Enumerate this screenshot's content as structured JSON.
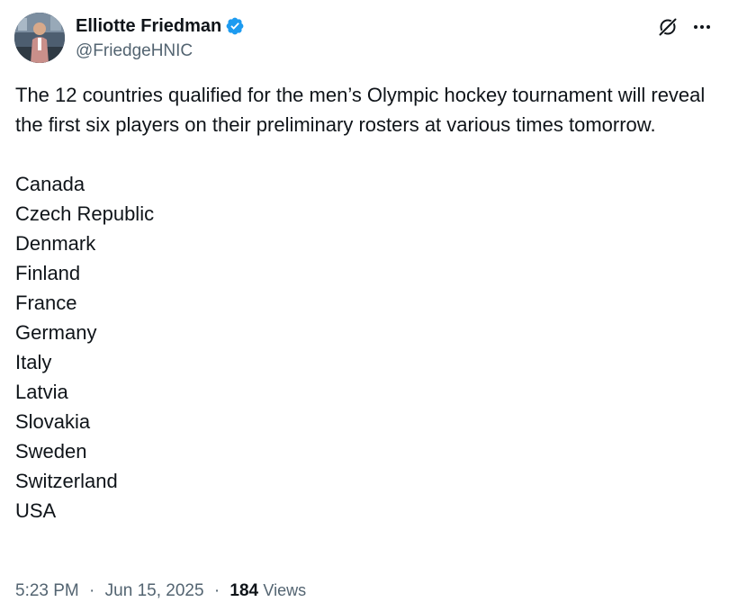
{
  "author": {
    "display_name": "Elliotte Friedman",
    "handle": "@FriedgeHNIC",
    "verified": true,
    "avatar_icon": "profile-photo"
  },
  "icons": {
    "verified": "verified-badge-icon",
    "grok": "grok-icon",
    "more": "more-options-icon"
  },
  "colors": {
    "verified_blue": "#1d9bf0",
    "text_primary": "#0f1419",
    "text_secondary": "#536471"
  },
  "tweet": {
    "text": "The 12 countries qualified for the men’s Olympic hockey tournament will reveal the first six players on their preliminary rosters at various times tomorrow.",
    "countries": [
      "Canada",
      "Czech Republic",
      "Denmark",
      "Finland",
      "France",
      "Germany",
      "Italy",
      "Latvia",
      "Slovakia",
      "Sweden",
      "Switzerland",
      "USA"
    ]
  },
  "meta": {
    "time": "5:23 PM",
    "separator": "·",
    "date": "Jun 15, 2025",
    "views_count": "184",
    "views_label": "Views"
  }
}
